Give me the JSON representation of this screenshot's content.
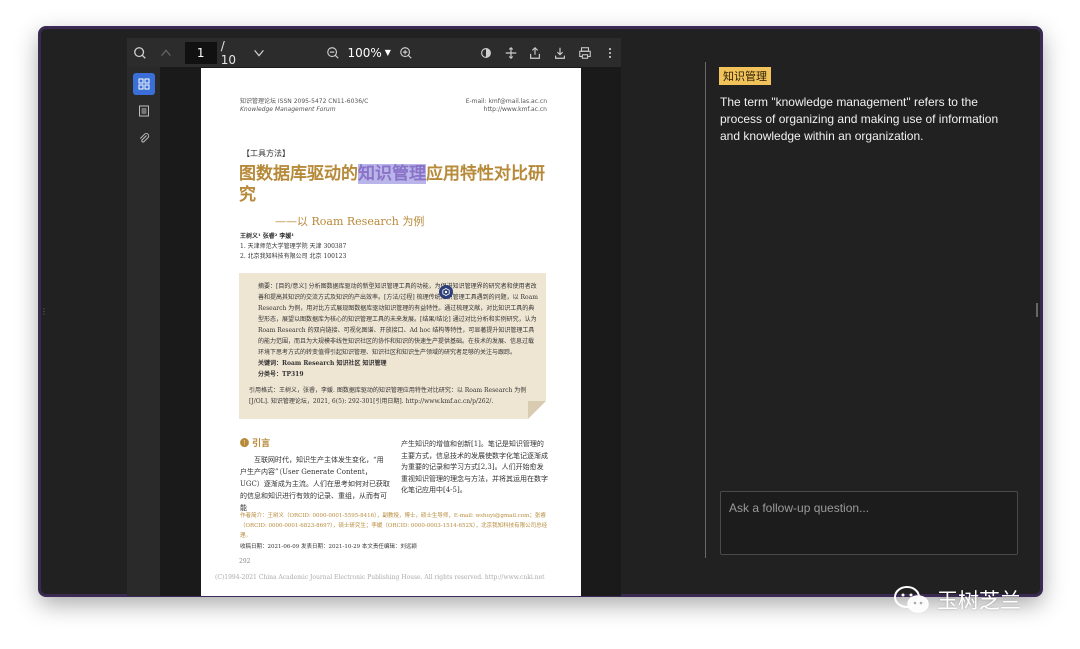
{
  "toolbar": {
    "page_current": "1",
    "page_total": "/ 10",
    "zoom": "100%",
    "icons": [
      "search-icon",
      "prev-page-icon",
      "next-page-icon",
      "zoom-out-icon",
      "zoom-in-icon",
      "theme-icon",
      "move-icon",
      "share-icon",
      "download-icon",
      "print-icon",
      "more-icon"
    ]
  },
  "sidebar": {
    "items": [
      {
        "icon": "thumbnails-icon",
        "active": true
      },
      {
        "icon": "outline-icon",
        "active": false
      },
      {
        "icon": "attachment-icon",
        "active": false
      }
    ]
  },
  "pdf": {
    "header_left_1": "知识管理论坛 ISSN 2095-5472 CN11-6036/C",
    "header_left_2": "Knowledge Management Forum",
    "header_right_1": "E-mail: kmf@mail.las.ac.cn",
    "header_right_2": "http://www.kmf.ac.cn",
    "tag": "【工具方法】",
    "title_pre": "图数据库驱动的",
    "title_highlight": "知识管理",
    "title_post": "应用特性对比研究",
    "subtitle": "——以 Roam Research 为例",
    "authors_1": "王树义¹ 张睿² 李媛¹",
    "authors_2": "1. 天津师范大学管理学院 天津 300387",
    "authors_3": "2. 北京我知科技有限公司 北京 100123",
    "abstract_text": "摘要：[目的/意义] 分析图数据库驱动的新型知识管理工具的功能，为促进知识管理界的研究者和使用者改善和提高其知识的交流方式及知识的产出效率。[方法/过程] 梳理传统知识管理工具遇到的问题，以 Roam Research 为例，用对比方式展现图数据库驱动知识管理的有益特性。通过梳理文献，对比知识工具的典型形态，展望以图数据库为核心的知识管理工具的未来发展。[结果/结论] 通过对比分析和实例研究，认为 Roam Research 的双向链接、可视化图谱、开放接口、Ad hoc 结构等特性，可显著提升知识管理工具的能力范围，而且为大规模非线性知识社区的协作和知识的快速生产提供基础。在技术的发展、信息过载环境下思考方式的转变值得引起知识管理、知识社区和知识生产领域的研究者足够的关注与跟踪。",
    "keywords": "关键词：Roam Research 知识社区 知识管理",
    "class_no": "分类号：TP319",
    "citation": "引用格式：王树义，张睿，李媛. 图数据库驱动的知识管理应用特性对比研究：以 Roam Research 为例[J/OL]. 知识管理论坛，2021, 6(5): 292-301[引用日期]. http://www.kmf.ac.cn/p/262/.",
    "section_heading": "❶ 引言",
    "col_left_text": "互联网时代，知识生产主体发生变化，“用户生产内容”（User Generate Content，UGC）逐渐成为主流。人们在思考如何对已获取的信息和知识进行有效的记录、重组，从而有可能",
    "col_right_text": "产生知识的增值和创新[1]。笔记是知识管理的主要方式，信息技术的发展使数字化笔记逐渐成为重要的记录和学习方式[2,3]。人们开始愈发重视知识管理的理念与方法，并将其运用在数字化笔记应用中[4-5]。",
    "author_note": "作者简介：王树义（ORCID: 0000-0001-5595-8416），副教授，博士，硕士生导师，E-mail: wshuyi@gmail.com；张睿（ORCID: 0000-0001-6823-8697），硕士研究生；李媛（ORCID: 0000-0003-1514-652X），北京我知科技有限公司总经理。",
    "dates": "收稿日期：2021-06-09    发表日期：2021-10-29    本文责任编辑：刘远颖",
    "page_number": "292",
    "footer": "(C)1994-2021 China Academic Journal Electronic Publishing House. All rights reserved.   http://www.cnki.net"
  },
  "panel": {
    "tag": "知识管理",
    "answer": "The term \"knowledge management\" refers to the process of organizing and making use of information and knowledge within an organization.",
    "ask_placeholder": "Ask a follow-up question..."
  },
  "watermark": {
    "text": "玉树芝兰",
    "icon": "wechat-icon"
  },
  "colors": {
    "window_bg": "#212121",
    "accent_tag": "#f2c35a",
    "highlight": "#b9b5ea",
    "title_gold": "#b78a3a",
    "active_blue": "#3a6fd8"
  }
}
